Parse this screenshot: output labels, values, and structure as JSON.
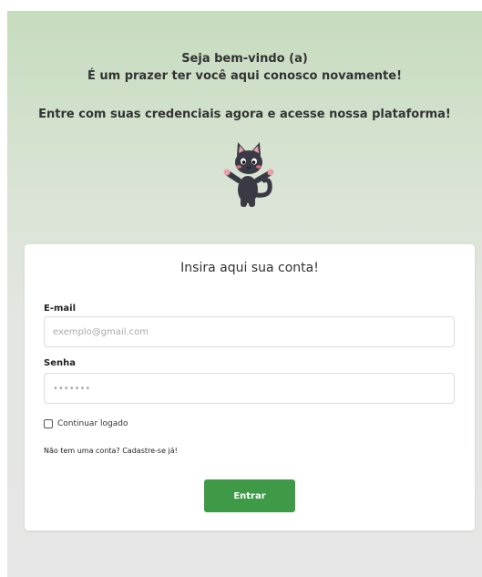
{
  "hero": {
    "welcome_line1": "Seja bem-vindo (a)",
    "welcome_line2": "É um prazer ter você aqui conosco novamente!",
    "welcome_line3": "Entre com suas credenciais agora e acesse nossa plataforma!"
  },
  "login": {
    "title": "Insira aqui sua conta!",
    "email_label": "E-mail",
    "email_placeholder": "exemplo@gmail.com",
    "password_label": "Senha",
    "password_placeholder": "•••••••",
    "remember_label": "Continuar logado",
    "signup_text": "Não tem uma conta? Cadastre-se já!",
    "submit_label": "Entrar"
  },
  "colors": {
    "accent": "#3f9a48",
    "header_bg": "#c6dcbe",
    "page_bg": "#e6e6e6"
  },
  "icons": {
    "mascot": "cat-mascot-icon"
  }
}
